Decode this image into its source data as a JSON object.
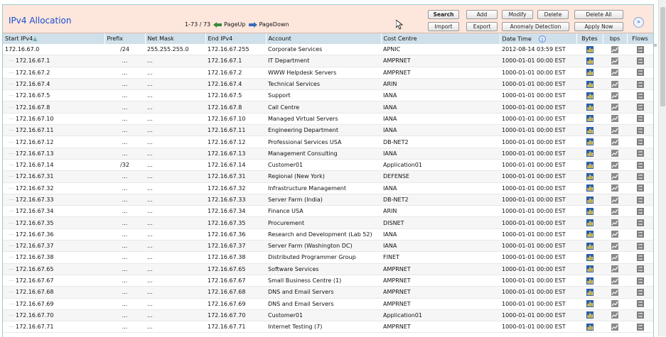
{
  "header": {
    "title": "IPv4 Allocation",
    "range": "1-73 / 73",
    "page_up": "PageUp",
    "page_down": "PageDown"
  },
  "buttons": {
    "search": "Search",
    "add": "Add",
    "modify": "Modify",
    "delete": "Delete",
    "delete_all": "Delete All",
    "import": "Import",
    "export": "Export",
    "anomaly_detection": "Anomaly Detection",
    "apply_now": "Apply Now"
  },
  "columns": {
    "start": "Start IPv4",
    "prefix": "Prefix",
    "mask": "Net Mask",
    "end": "End IPv4",
    "account": "Account",
    "cost_centre": "Cost Centre",
    "datetime": "Date Time",
    "bytes": "Bytes",
    "bps": "bps",
    "flows": "Flows"
  },
  "rows": [
    {
      "start": "172.16.67.0",
      "prefix": "/24",
      "mask": "255.255.255.0",
      "end": "172.16.67.255",
      "account": "Corporate Services",
      "cc": "APNIC",
      "dt": "2012-08-14 03:59 EST"
    },
    {
      "start": "172.16.67.1",
      "prefix": "...",
      "mask": "...",
      "end": "172.16.67.1",
      "account": "IT Department",
      "cc": "AMPRNET",
      "dt": "1000-01-01 00:00 EST"
    },
    {
      "start": "172.16.67.2",
      "prefix": "...",
      "mask": "...",
      "end": "172.16.67.2",
      "account": "WWW Helpdesk Servers",
      "cc": "AMPRNET",
      "dt": "1000-01-01 00:00 EST"
    },
    {
      "start": "172.16.67.4",
      "prefix": "...",
      "mask": "...",
      "end": "172.16.67.4",
      "account": "Technical Services",
      "cc": "ARIN",
      "dt": "1000-01-01 00:00 EST"
    },
    {
      "start": "172.16.67.5",
      "prefix": "...",
      "mask": "...",
      "end": "172.16.67.5",
      "account": "Support",
      "cc": "IANA",
      "dt": "1000-01-01 00:00 EST"
    },
    {
      "start": "172.16.67.8",
      "prefix": "...",
      "mask": "...",
      "end": "172.16.67.8",
      "account": "Call Centre",
      "cc": "IANA",
      "dt": "1000-01-01 00:00 EST"
    },
    {
      "start": "172.16.67.10",
      "prefix": "...",
      "mask": "...",
      "end": "172.16.67.10",
      "account": "Managed Virtual Servers",
      "cc": "IANA",
      "dt": "1000-01-01 00:00 EST"
    },
    {
      "start": "172.16.67.11",
      "prefix": "...",
      "mask": "...",
      "end": "172.16.67.11",
      "account": "Engineering Department",
      "cc": "IANA",
      "dt": "1000-01-01 00:00 EST"
    },
    {
      "start": "172.16.67.12",
      "prefix": "...",
      "mask": "...",
      "end": "172.16.67.12",
      "account": "Professional Services USA",
      "cc": "DB-NET2",
      "dt": "1000-01-01 00:00 EST"
    },
    {
      "start": "172.16.67.13",
      "prefix": "...",
      "mask": "...",
      "end": "172.16.67.13",
      "account": "Management Consulting",
      "cc": "IANA",
      "dt": "1000-01-01 00:00 EST"
    },
    {
      "start": "172.16.67.14",
      "prefix": "/32",
      "mask": "...",
      "end": "172.16.67.14",
      "account": "Customer01",
      "cc": "Application01",
      "dt": "1000-01-01 00:00 EST"
    },
    {
      "start": "172.16.67.31",
      "prefix": "...",
      "mask": "...",
      "end": "172.16.67.31",
      "account": "Regional (New York)",
      "cc": "DEFENSE",
      "dt": "1000-01-01 00:00 EST"
    },
    {
      "start": "172.16.67.32",
      "prefix": "...",
      "mask": "...",
      "end": "172.16.67.32",
      "account": "Infrastructure Management",
      "cc": "IANA",
      "dt": "1000-01-01 00:00 EST"
    },
    {
      "start": "172.16.67.33",
      "prefix": "...",
      "mask": "...",
      "end": "172.16.67.33",
      "account": "Server Farm (India)",
      "cc": "DB-NET2",
      "dt": "1000-01-01 00:00 EST"
    },
    {
      "start": "172.16.67.34",
      "prefix": "...",
      "mask": "...",
      "end": "172.16.67.34",
      "account": "Finance USA",
      "cc": "ARIN",
      "dt": "1000-01-01 00:00 EST"
    },
    {
      "start": "172.16.67.35",
      "prefix": "...",
      "mask": "...",
      "end": "172.16.67.35",
      "account": "Procurement",
      "cc": "DISNET",
      "dt": "1000-01-01 00:00 EST"
    },
    {
      "start": "172.16.67.36",
      "prefix": "...",
      "mask": "...",
      "end": "172.16.67.36",
      "account": "Research and Development (Lab 52)",
      "cc": "IANA",
      "dt": "1000-01-01 00:00 EST"
    },
    {
      "start": "172.16.67.37",
      "prefix": "...",
      "mask": "...",
      "end": "172.16.67.37",
      "account": "Server Farm (Washington DC)",
      "cc": "IANA",
      "dt": "1000-01-01 00:00 EST"
    },
    {
      "start": "172.16.67.38",
      "prefix": "...",
      "mask": "...",
      "end": "172.16.67.38",
      "account": "Distributed Programmer Group",
      "cc": "FINET",
      "dt": "1000-01-01 00:00 EST"
    },
    {
      "start": "172.16.67.65",
      "prefix": "...",
      "mask": "...",
      "end": "172.16.67.65",
      "account": "Software Services",
      "cc": "AMPRNET",
      "dt": "1000-01-01 00:00 EST"
    },
    {
      "start": "172.16.67.67",
      "prefix": "...",
      "mask": "...",
      "end": "172.16.67.67",
      "account": "Small Business Centre (1)",
      "cc": "AMPRNET",
      "dt": "1000-01-01 00:00 EST"
    },
    {
      "start": "172.16.67.68",
      "prefix": "...",
      "mask": "...",
      "end": "172.16.67.68",
      "account": "DNS and Email Servers",
      "cc": "AMPRNET",
      "dt": "1000-01-01 00:00 EST"
    },
    {
      "start": "172.16.67.69",
      "prefix": "...",
      "mask": "...",
      "end": "172.16.67.69",
      "account": "DNS and Email Servers",
      "cc": "AMPRNET",
      "dt": "1000-01-01 00:00 EST"
    },
    {
      "start": "172.16.67.70",
      "prefix": "...",
      "mask": "...",
      "end": "172.16.67.70",
      "account": "Customer01",
      "cc": "Application01",
      "dt": "1000-01-01 00:00 EST"
    },
    {
      "start": "172.16.67.71",
      "prefix": "...",
      "mask": "...",
      "end": "172.16.67.71",
      "account": "Internet Testing (7)",
      "cc": "AMPRNET",
      "dt": "1000-01-01 00:00 EST"
    }
  ],
  "icons": {
    "bytes": "bar-chart-icon",
    "bps": "graph-icon",
    "flows": "flows-icon",
    "sort": "sort-arrow-icon",
    "timezone": "info-icon",
    "expand": "expand-chevron-icon"
  },
  "colors": {
    "header_bg": "#fde6dc",
    "title": "#1a4fd0",
    "column_header_bg": "#cfe0ea"
  }
}
